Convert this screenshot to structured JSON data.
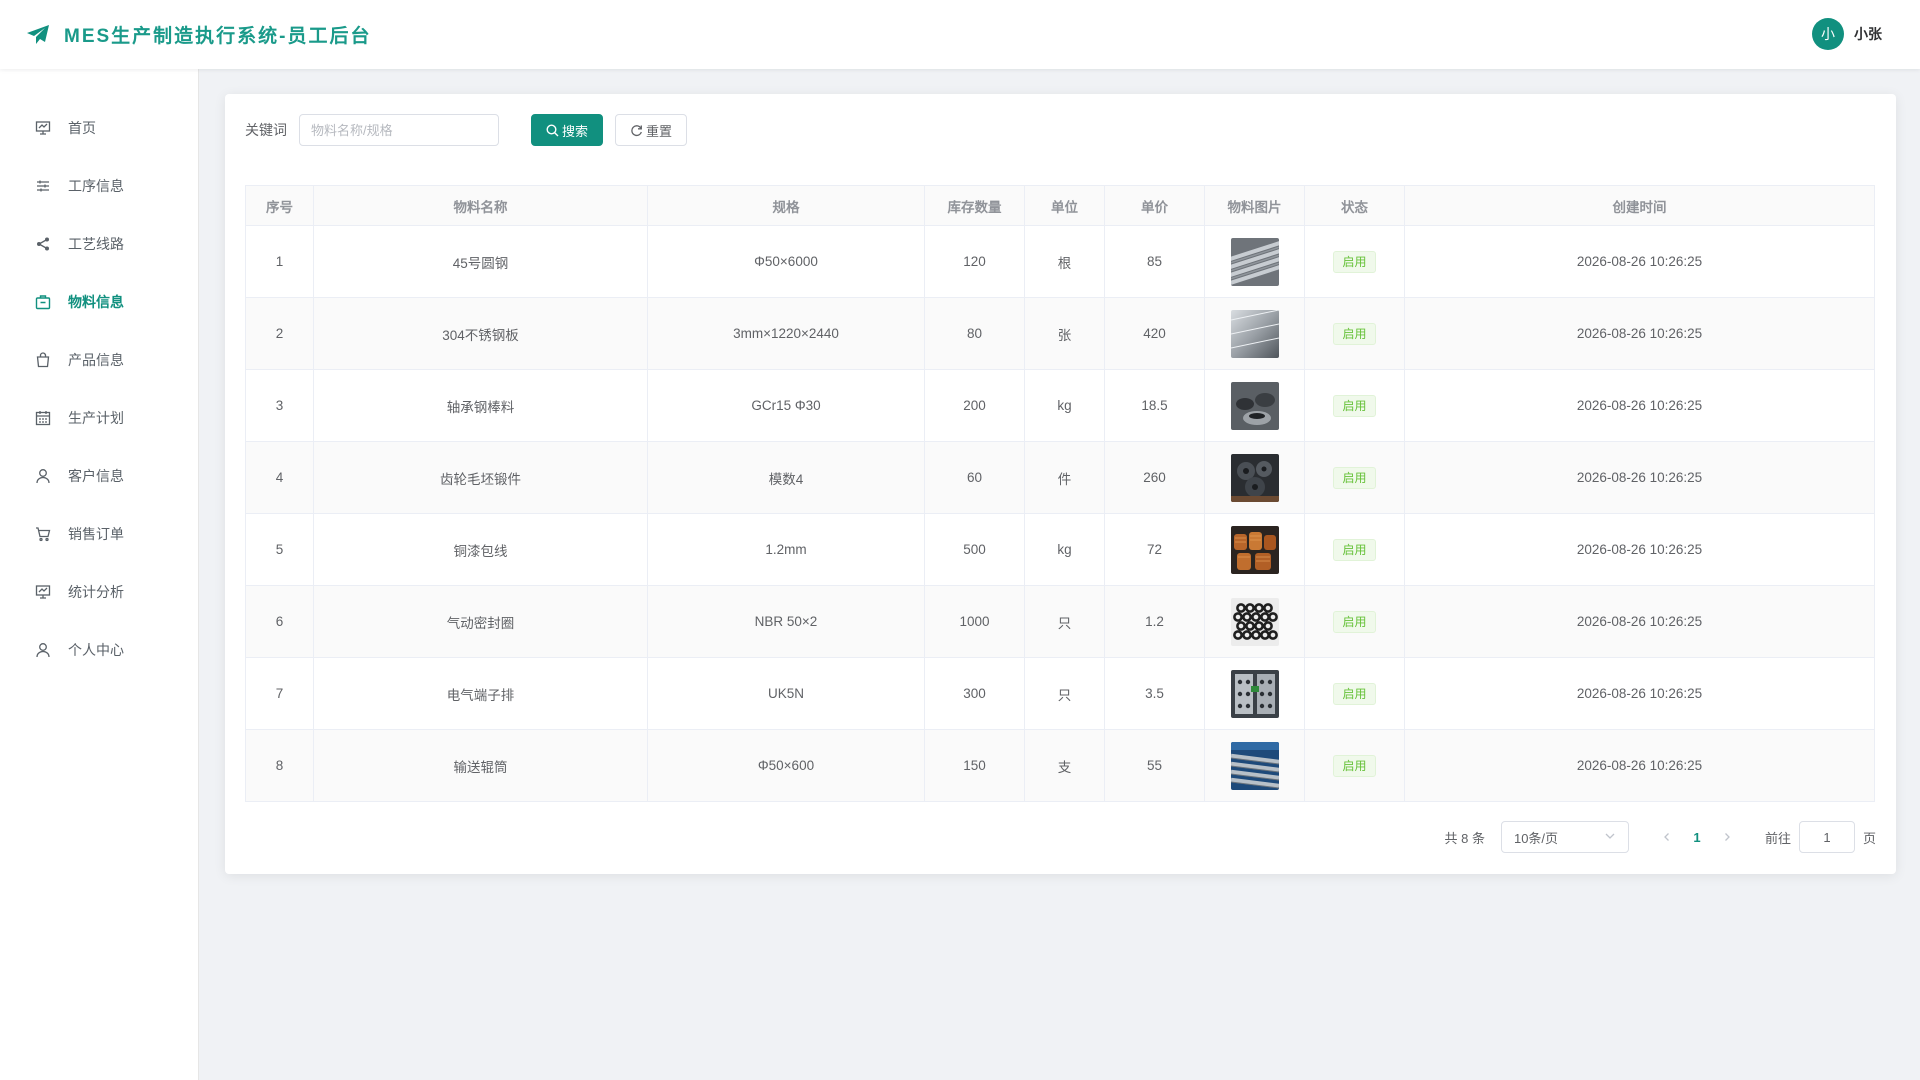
{
  "header": {
    "title": "MES生产制造执行系统-员工后台",
    "user_initial": "小",
    "user_name": "小张",
    "brand_color": "#11907f"
  },
  "sidebar": {
    "items": [
      {
        "label": "首页",
        "icon": "dashboard-icon",
        "active": false
      },
      {
        "label": "工序信息",
        "icon": "sliders-icon",
        "active": false
      },
      {
        "label": "工艺线路",
        "icon": "share-icon",
        "active": false
      },
      {
        "label": "物料信息",
        "icon": "box-icon",
        "active": true
      },
      {
        "label": "产品信息",
        "icon": "shopping-bag-icon",
        "active": false
      },
      {
        "label": "生产计划",
        "icon": "calendar-icon",
        "active": false
      },
      {
        "label": "客户信息",
        "icon": "user-icon",
        "active": false
      },
      {
        "label": "销售订单",
        "icon": "cart-icon",
        "active": false
      },
      {
        "label": "统计分析",
        "icon": "chart-board-icon",
        "active": false
      },
      {
        "label": "个人中心",
        "icon": "user-icon",
        "active": false
      }
    ]
  },
  "search": {
    "label": "关键词",
    "placeholder": "物料名称/规格",
    "value": "",
    "search_label": "搜索",
    "reset_label": "重置"
  },
  "table": {
    "columns": [
      "序号",
      "物料名称",
      "规格",
      "库存数量",
      "单位",
      "单价",
      "物料图片",
      "状态",
      "创建时间"
    ],
    "rows": [
      {
        "no": "1",
        "name": "45号圆钢",
        "spec": "Φ50×6000",
        "qty": "120",
        "unit": "根",
        "price": "85",
        "image": "steel-bars",
        "status": "启用",
        "created": "2026-08-26 10:26:25"
      },
      {
        "no": "2",
        "name": "304不锈钢板",
        "spec": "3mm×1220×2440",
        "qty": "80",
        "unit": "张",
        "price": "420",
        "image": "steel-plate",
        "status": "启用",
        "created": "2026-08-26 10:26:25"
      },
      {
        "no": "3",
        "name": "轴承钢棒料",
        "spec": "GCr15 Φ30",
        "qty": "200",
        "unit": "kg",
        "price": "18.5",
        "image": "bearing-bars",
        "status": "启用",
        "created": "2026-08-26 10:26:25"
      },
      {
        "no": "4",
        "name": "齿轮毛坯锻件",
        "spec": "模数4",
        "qty": "60",
        "unit": "件",
        "price": "260",
        "image": "gear-blanks",
        "status": "启用",
        "created": "2026-08-26 10:26:25"
      },
      {
        "no": "5",
        "name": "铜漆包线",
        "spec": "1.2mm",
        "qty": "500",
        "unit": "kg",
        "price": "72",
        "image": "copper-coils",
        "status": "启用",
        "created": "2026-08-26 10:26:25"
      },
      {
        "no": "6",
        "name": "气动密封圈",
        "spec": "NBR 50×2",
        "qty": "1000",
        "unit": "只",
        "price": "1.2",
        "image": "o-rings",
        "status": "启用",
        "created": "2026-08-26 10:26:25"
      },
      {
        "no": "7",
        "name": "电气端子排",
        "spec": "UK5N",
        "qty": "300",
        "unit": "只",
        "price": "3.5",
        "image": "terminal-blocks",
        "status": "启用",
        "created": "2026-08-26 10:26:25"
      },
      {
        "no": "8",
        "name": "输送辊筒",
        "spec": "Φ50×600",
        "qty": "150",
        "unit": "支",
        "price": "55",
        "image": "conveyor-rollers",
        "status": "启用",
        "created": "2026-08-26 10:26:25"
      }
    ]
  },
  "pagination": {
    "total_label": "共 8 条",
    "page_size": "10条/页",
    "current_page": "1",
    "goto_label": "前往",
    "goto_value": "1",
    "page_suffix": "页"
  }
}
